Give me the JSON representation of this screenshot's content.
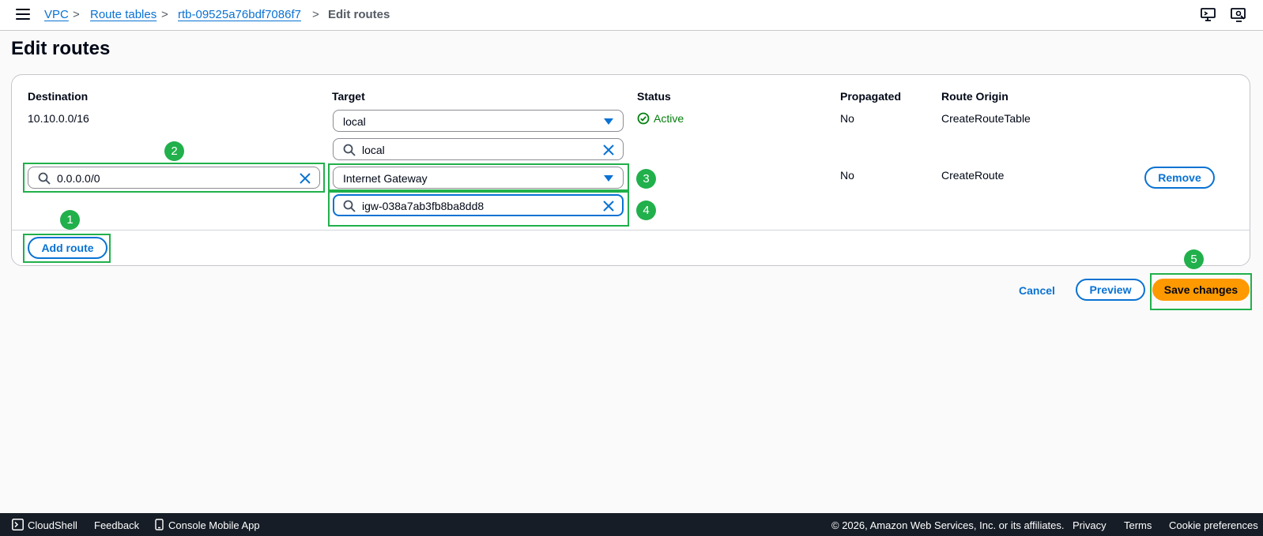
{
  "breadcrumb": {
    "vpc": "VPC",
    "route_tables": "Route tables",
    "route_table_id": "rtb-09525a76bdf7086f7",
    "current": "Edit routes",
    "separator": ">"
  },
  "page": {
    "title": "Edit routes"
  },
  "columns": {
    "destination": "Destination",
    "target": "Target",
    "status": "Status",
    "propagated": "Propagated",
    "route_origin": "Route Origin"
  },
  "routes": [
    {
      "destination": "10.10.0.0/16",
      "target_selected": "local",
      "target_filter": "local",
      "status": "Active",
      "propagated": "No",
      "route_origin": "CreateRouteTable"
    },
    {
      "destination_value": "0.0.0.0/0",
      "target_selected": "Internet Gateway",
      "target_filter": "igw-038a7ab3fb8ba8dd8",
      "propagated": "No",
      "route_origin": "CreateRoute",
      "remove_label": "Remove"
    }
  ],
  "actions": {
    "add_route": "Add route",
    "cancel": "Cancel",
    "preview": "Preview",
    "save": "Save changes"
  },
  "annotations": [
    "1",
    "2",
    "3",
    "4",
    "5"
  ],
  "footer": {
    "cloudshell": "CloudShell",
    "feedback": "Feedback",
    "mobile_app": "Console Mobile App",
    "copyright": "© 2026, Amazon Web Services, Inc. or its affiliates.",
    "privacy": "Privacy",
    "terms": "Terms",
    "cookies": "Cookie preferences"
  },
  "icons": {
    "menu": "menu-icon",
    "top_right_1": "notification-screen-icon",
    "top_right_2": "monitor-settings-icon",
    "search": "search-icon",
    "clear": "close-icon",
    "caret": "caret-down-icon",
    "status_ok": "check-circle-icon",
    "cloudshell": "terminal-icon",
    "mobile": "mobile-device-icon"
  },
  "colors": {
    "link": "#0972d3",
    "primary_button": "#ff9900",
    "success": "#037f0c",
    "annotation": "#21b04b",
    "footer_bg": "#161d26"
  }
}
